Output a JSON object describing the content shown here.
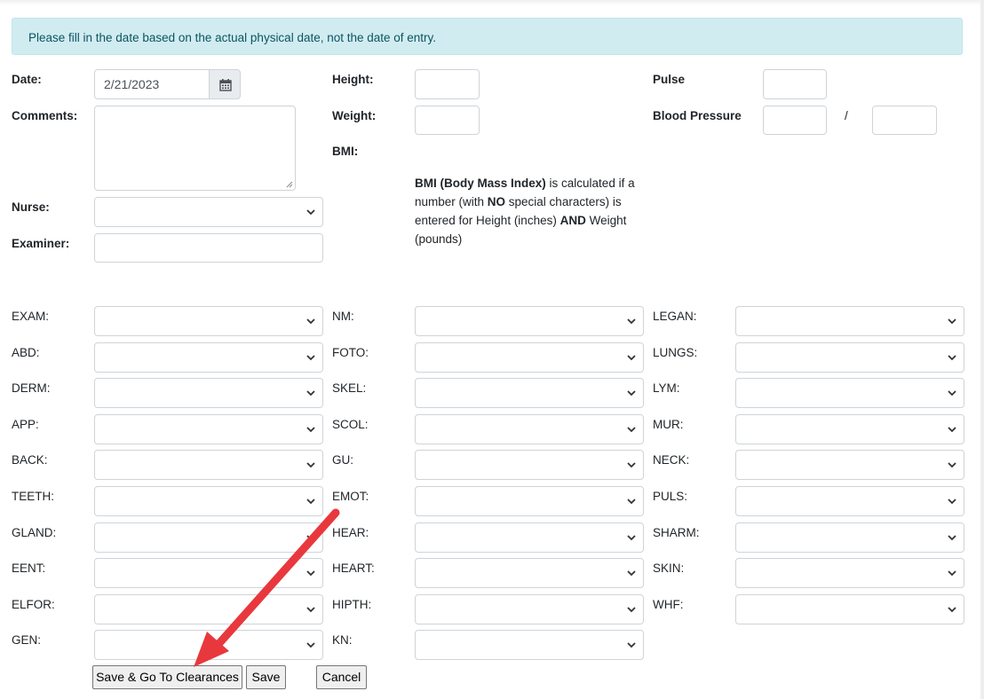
{
  "alert": {
    "message": "Please fill in the date based on the actual physical date, not the date of entry."
  },
  "vitals": {
    "date_label": "Date:",
    "date_value": "2/21/2023",
    "comments_label": "Comments:",
    "nurse_label": "Nurse:",
    "examiner_label": "Examiner:",
    "height_label": "Height:",
    "weight_label": "Weight:",
    "bmi_label": "BMI:",
    "pulse_label": "Pulse",
    "bp_label": "Blood Pressure",
    "bp_separator": "/"
  },
  "bmi_note": {
    "p1": "BMI (Body Mass Index)",
    "p2": " is calculated if a number (with ",
    "p3": "NO",
    "p4": " special characters) is entered for Height (inches) ",
    "p5": "AND",
    "p6": " Weight (pounds)"
  },
  "exam_fields": {
    "col1": [
      "EXAM:",
      "ABD:",
      "DERM:",
      "APP:",
      "BACK:",
      "TEETH:",
      "GLAND:",
      "EENT:",
      "ELFOR:",
      "GEN:"
    ],
    "col2": [
      "NM:",
      "FOTO:",
      "SKEL:",
      "SCOL:",
      "GU:",
      "EMOT:",
      "HEAR:",
      "HEART:",
      "HIPTH:",
      "KN:"
    ],
    "col3": [
      "LEGAN:",
      "LUNGS:",
      "LYM:",
      "MUR:",
      "NECK:",
      "PULS:",
      "SHARM:",
      "SKIN:",
      "WHF:"
    ]
  },
  "buttons": {
    "save_clearances": "Save & Go To Clearances",
    "save": "Save",
    "cancel": "Cancel"
  },
  "colors": {
    "alert_bg": "#d1ecf1",
    "alert_text": "#0c5460",
    "arrow": "#e8383d"
  }
}
